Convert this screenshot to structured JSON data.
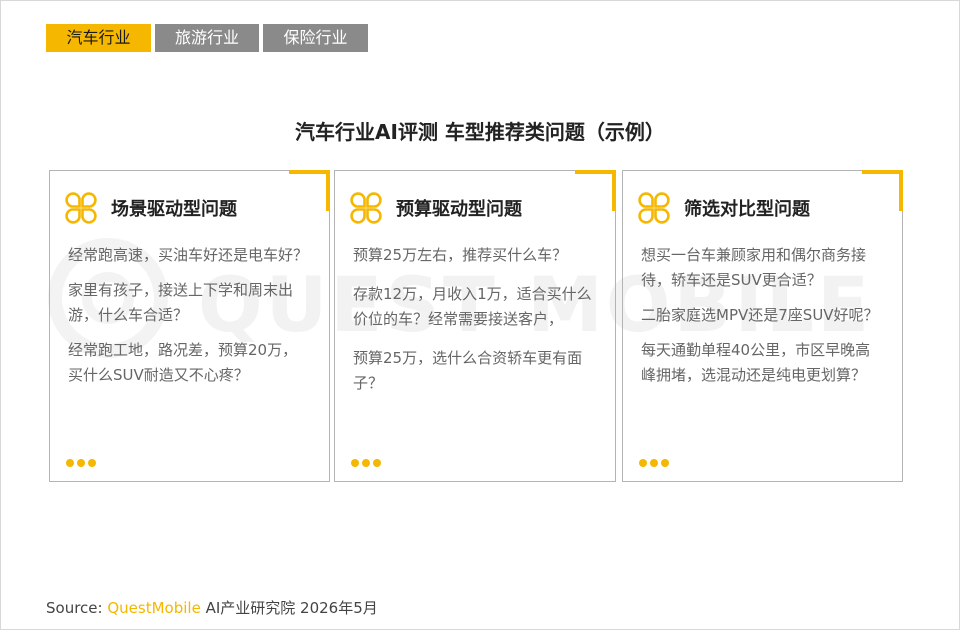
{
  "tabs": [
    {
      "label": "汽车行业",
      "active": true
    },
    {
      "label": "旅游行业",
      "active": false
    },
    {
      "label": "保险行业",
      "active": false
    }
  ],
  "watermark_text": "QUEST MOBILE",
  "title": "汽车行业AI评测  车型推荐类问题（示例）",
  "cards": [
    {
      "title": "场景驱动型问题",
      "questions": [
        "经常跑高速，买油车好还是电车好？",
        "家里有孩子，接送上下学和周末出游，什么车合适？",
        "经常跑工地，路况差，预算20万，买什么SUV耐造又不心疼？"
      ]
    },
    {
      "title": "预算驱动型问题",
      "questions": [
        "预算25万左右，推荐买什么车？",
        "存款12万，月收入1万，适合买什么价位的车？经常需要接送客户，",
        "预算25万，选什么合资轿车更有面子？"
      ]
    },
    {
      "title": "筛选对比型问题",
      "questions": [
        "想买一台车兼顾家用和偶尔商务接待，轿车还是SUV更合适？",
        "二胎家庭选MPV还是7座SUV好呢？",
        "每天通勤单程40公里，市区早晚高峰拥堵，选混动还是纯电更划算？"
      ]
    }
  ],
  "source": {
    "prefix": "Source:",
    "brand": "QuestMobile",
    "suffix": " AI产业研究院 2026年5月"
  },
  "colors": {
    "accent": "#f5b700",
    "tab_inactive": "#8a8a8a",
    "card_border": "#b4b4b4"
  },
  "icons": {
    "card_icon": "four-leaf-clover-icon",
    "more": "three-dots-icon"
  }
}
